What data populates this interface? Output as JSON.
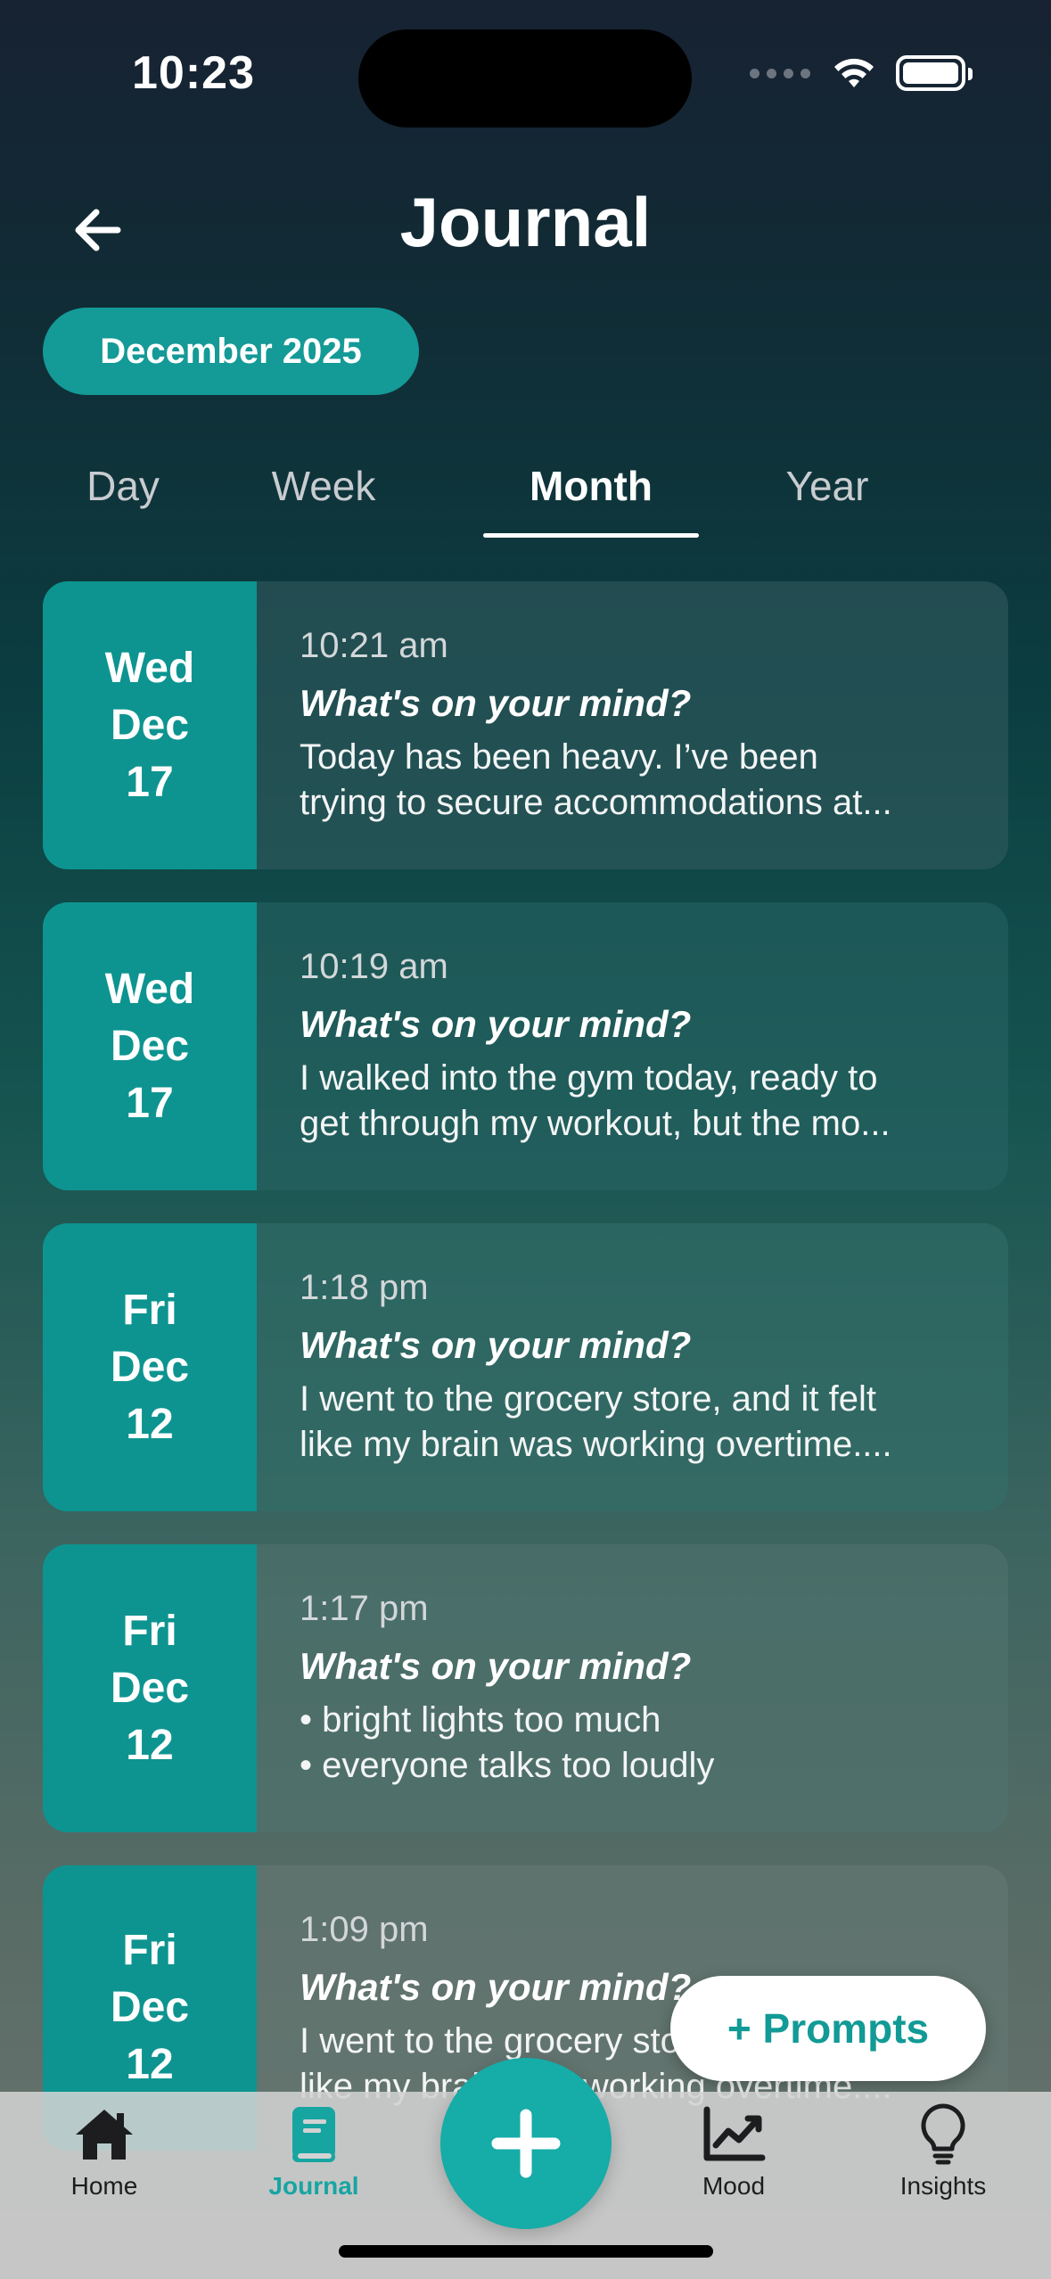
{
  "status_bar": {
    "time": "10:23"
  },
  "header": {
    "title": "Journal"
  },
  "period_selector": {
    "label": "December 2025"
  },
  "tabs": [
    {
      "label": "Day"
    },
    {
      "label": "Week"
    },
    {
      "label": "Month"
    },
    {
      "label": "Year"
    }
  ],
  "active_tab": "Month",
  "entries": [
    {
      "weekday": "Wed",
      "month": "Dec",
      "day": "17",
      "time": "10:21 am",
      "prompt": "What's on your mind?",
      "lines": [
        "Today has been heavy. I’ve been",
        "trying to secure accommodations at..."
      ]
    },
    {
      "weekday": "Wed",
      "month": "Dec",
      "day": "17",
      "time": "10:19 am",
      "prompt": "What's on your mind?",
      "lines": [
        "I walked into the gym today, ready to",
        "get through my workout, but the mo..."
      ]
    },
    {
      "weekday": "Fri",
      "month": "Dec",
      "day": "12",
      "time": "1:18 pm",
      "prompt": "What's on your mind?",
      "lines": [
        "I went to the grocery store, and it felt",
        "like my brain was working overtime...."
      ]
    },
    {
      "weekday": "Fri",
      "month": "Dec",
      "day": "12",
      "time": "1:17 pm",
      "prompt": "What's on your mind?",
      "lines": [
        "• bright lights too much",
        "• everyone talks too loudly"
      ]
    },
    {
      "weekday": "Fri",
      "month": "Dec",
      "day": "12",
      "time": "1:09 pm",
      "prompt": "What's on your mind?",
      "lines": [
        "I went to the grocery store, and it felt",
        "like my brain was working overtime...."
      ]
    }
  ],
  "prompts_button": {
    "label": "+ Prompts"
  },
  "nav": {
    "home": "Home",
    "journal": "Journal",
    "mood": "Mood",
    "insights": "Insights"
  },
  "colors": {
    "accent": "#149a97",
    "date_block": "#0d9490"
  }
}
